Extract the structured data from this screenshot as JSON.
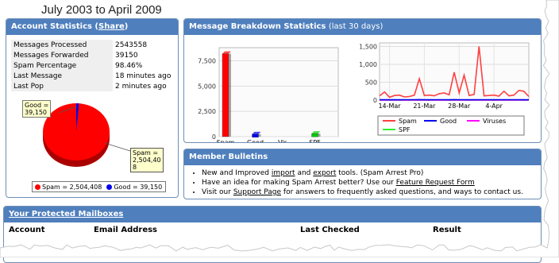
{
  "page_title": "July 2003 to April 2009",
  "account": {
    "title": "Account Statistics (",
    "share_link": "Share",
    "title_close": ")",
    "rows": [
      {
        "label": "Messages Processed",
        "value": "2543558"
      },
      {
        "label": "Messages Forwarded",
        "value": "39150"
      },
      {
        "label": "Spam Percentage",
        "value": "98.46%"
      },
      {
        "label": "Last Message",
        "value": "18 minutes ago"
      },
      {
        "label": "Last Pop",
        "value": "2 minutes ago"
      }
    ],
    "good_callout": [
      "Good =",
      "39,150"
    ],
    "spam_callout": [
      "Spam =",
      "2,504,40",
      "8"
    ],
    "legend_spam": "Spam = 2,504,408",
    "legend_good": "Good = 39,150",
    "colors": {
      "spam": "#ff0000",
      "good": "#0000ee"
    }
  },
  "breakdown": {
    "title": "Message Breakdown Statistics",
    "subtitle": "(last 30 days)"
  },
  "chart_data": [
    {
      "type": "bar",
      "categories": [
        "Spam",
        "Good",
        "Vir...",
        "SPF"
      ],
      "values": [
        8200,
        250,
        0,
        300
      ],
      "y_ticks": [
        "7,500",
        "5,000",
        "2,500",
        "0"
      ],
      "ylim": [
        0,
        8800
      ],
      "colors": [
        "#ff0000",
        "#0000ee",
        "#ff00ff",
        "#00cc00"
      ],
      "grid": true
    },
    {
      "type": "line",
      "x_ticks": [
        "14-Mar",
        "21-Mar",
        "28-Mar",
        "4-Apr"
      ],
      "y_ticks": [
        "1,500",
        "1,000",
        "500",
        "0"
      ],
      "ylim": [
        0,
        1600
      ],
      "series": [
        {
          "name": "Spam",
          "color": "#ff4040",
          "values": [
            120,
            230,
            80,
            130,
            140,
            90,
            100,
            140,
            600,
            130,
            140,
            120,
            180,
            200,
            150,
            780,
            200,
            700,
            130,
            160,
            1500,
            120,
            130,
            140,
            110,
            250,
            120,
            140,
            270,
            250,
            100
          ]
        },
        {
          "name": "Good",
          "color": "#0000ee",
          "values": [
            10,
            12,
            8,
            10,
            9,
            11,
            10,
            12,
            14,
            10,
            9,
            11,
            12,
            10,
            9,
            13,
            10,
            12,
            9,
            11,
            10,
            12,
            10,
            9,
            11,
            10,
            12,
            10,
            11,
            9,
            10
          ]
        },
        {
          "name": "Viruses",
          "color": "#ff00ff",
          "values": [
            0,
            0,
            0,
            0,
            0,
            0,
            0,
            0,
            0,
            0,
            0,
            0,
            0,
            0,
            0,
            0,
            0,
            0,
            0,
            0,
            0,
            0,
            0,
            0,
            0,
            0,
            0,
            0,
            0,
            0,
            0
          ]
        },
        {
          "name": "SPF",
          "color": "#33ee33",
          "values": [
            3,
            2,
            4,
            3,
            2,
            3,
            4,
            2,
            3,
            3,
            2,
            4,
            3,
            2,
            3,
            4,
            3,
            2,
            3,
            3,
            4,
            2,
            3,
            3,
            2,
            3,
            4,
            3,
            2,
            3,
            3
          ]
        }
      ],
      "grid": true,
      "legend": "bottom"
    }
  ],
  "bulletins": {
    "title": "Member Bulletins",
    "items": [
      {
        "pre": "New and Improved ",
        "link1": "import",
        "mid": " and ",
        "link2": "export",
        "post": " tools. (Spam Arrest Pro)"
      },
      {
        "pre": "Have an idea for making Spam Arrest better? Use our ",
        "link1": "Feature Request Form",
        "mid": "",
        "link2": "",
        "post": ""
      },
      {
        "pre": "Visit our ",
        "link1": "Support Page",
        "mid": "",
        "link2": "",
        "post": " for answers to frequently asked questions, and ways to contact us."
      }
    ]
  },
  "mailboxes": {
    "title": "Your Protected Mailboxes",
    "columns": [
      "Account",
      "Email Address",
      "Last Checked",
      "Result"
    ]
  }
}
